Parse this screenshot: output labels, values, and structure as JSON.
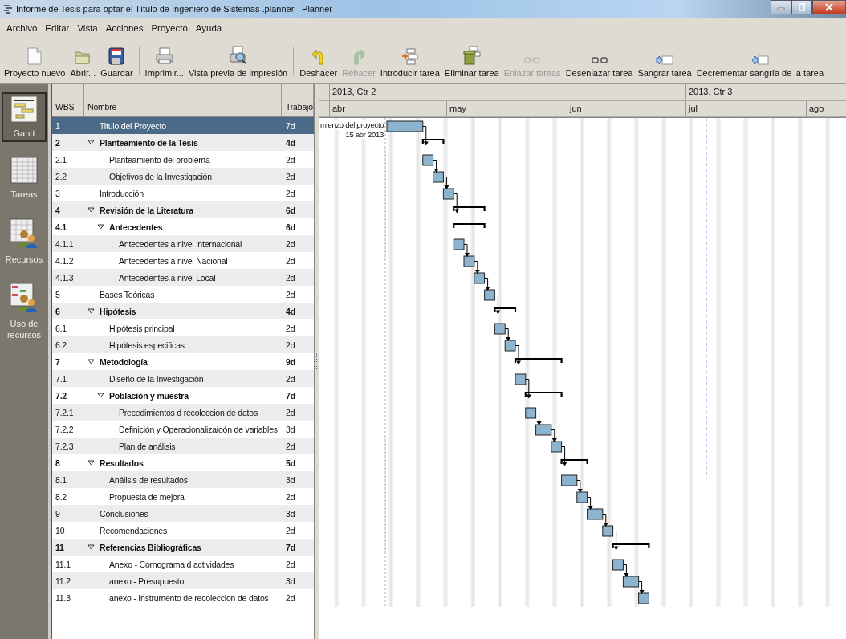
{
  "window": {
    "title": "Informe de Tesis para optar el Título de Ingeniero de Sistemas .planner - Planner"
  },
  "menu": [
    "Archivo",
    "Editar",
    "Vista",
    "Acciones",
    "Proyecto",
    "Ayuda"
  ],
  "toolbar": [
    [
      {
        "kind": "new",
        "label": "Proyecto nuevo",
        "disabled": false
      },
      {
        "kind": "open",
        "label": "Abrir...",
        "disabled": false
      },
      {
        "kind": "save",
        "label": "Guardar",
        "disabled": false
      }
    ],
    [
      {
        "kind": "print",
        "label": "Imprimir...",
        "disabled": false
      },
      {
        "kind": "preview",
        "label": "Vista previa de impresión",
        "disabled": false
      }
    ],
    [
      {
        "kind": "undo",
        "label": "Deshacer",
        "disabled": false
      },
      {
        "kind": "redo",
        "label": "Rehacer",
        "disabled": true
      },
      {
        "kind": "insert",
        "label": "Introducir tarea",
        "disabled": false
      },
      {
        "kind": "delete",
        "label": "Eliminar tarea",
        "disabled": false
      },
      {
        "kind": "link",
        "label": "Enlazar tareas",
        "disabled": true
      },
      {
        "kind": "unlink",
        "label": "Desenlazar tarea",
        "disabled": false
      },
      {
        "kind": "indent",
        "label": "Sangrar tarea",
        "disabled": false
      },
      {
        "kind": "unindent",
        "label": "Decrementar sangría de la tarea",
        "disabled": false
      }
    ]
  ],
  "sidebar": {
    "items": [
      {
        "kind": "gantt",
        "label": "Gantt",
        "selected": true
      },
      {
        "kind": "tasks",
        "label": "Tareas",
        "selected": false
      },
      {
        "kind": "resources",
        "label": "Recursos",
        "selected": false
      },
      {
        "kind": "usage",
        "label": "Uso de recursos",
        "selected": false
      }
    ]
  },
  "table": {
    "columns": [
      "WBS",
      "Nombre",
      "Trabajo"
    ],
    "rows": [
      {
        "wbs": "1",
        "name": "Titulo del Proyecto",
        "work": "7d",
        "selected": true
      },
      {
        "wbs": "2",
        "name": "Planteamiento de la Tesis",
        "work": "4d",
        "selected": false,
        "expanded": true,
        "children": [
          {
            "wbs": "2.1",
            "name": "Planteamiento del problema",
            "work": "2d",
            "selected": false
          },
          {
            "wbs": "2.2",
            "name": "Objetivos de la Investigación",
            "work": "2d",
            "selected": false
          }
        ]
      },
      {
        "wbs": "3",
        "name": "Introducción",
        "work": "2d",
        "selected": false
      },
      {
        "wbs": "4",
        "name": "Revisión de la Literatura",
        "work": "6d",
        "selected": false,
        "expanded": true,
        "children": [
          {
            "wbs": "4.1",
            "name": "Antecedentes",
            "work": "6d",
            "selected": false,
            "expanded": true,
            "children": [
              {
                "wbs": "4.1.1",
                "name": "Antecedentes a nivel internacional",
                "work": "2d",
                "selected": false
              },
              {
                "wbs": "4.1.2",
                "name": "Antecedentes a nivel Nacional",
                "work": "2d",
                "selected": false
              },
              {
                "wbs": "4.1.3",
                "name": "Antecedentes a nivel Local",
                "work": "2d",
                "selected": false
              }
            ]
          }
        ]
      },
      {
        "wbs": "5",
        "name": "Bases Teóricas",
        "work": "2d",
        "selected": false
      },
      {
        "wbs": "6",
        "name": "Hipótesis",
        "work": "4d",
        "selected": false,
        "expanded": true,
        "children": [
          {
            "wbs": "6.1",
            "name": "Hipótesis principal",
            "work": "2d",
            "selected": false
          },
          {
            "wbs": "6.2",
            "name": "Hipótesis especificas",
            "work": "2d",
            "selected": false
          }
        ]
      },
      {
        "wbs": "7",
        "name": "Metodología",
        "work": "9d",
        "selected": false,
        "expanded": true,
        "children": [
          {
            "wbs": "7.1",
            "name": "Diseño de la Investigación",
            "work": "2d",
            "selected": false
          },
          {
            "wbs": "7.2",
            "name": "Población y muestra",
            "work": "7d",
            "selected": false,
            "expanded": true,
            "children": [
              {
                "wbs": "7.2.1",
                "name": "Precedimientos d recoleccion de datos",
                "work": "2d",
                "selected": false
              },
              {
                "wbs": "7.2.2",
                "name": "Definición y Operacionalizaioón de variables",
                "work": "3d",
                "selected": false
              },
              {
                "wbs": "7.2.3",
                "name": "Plan de análisis",
                "work": "2d",
                "selected": false
              }
            ]
          }
        ]
      },
      {
        "wbs": "8",
        "name": "Resultados",
        "work": "5d",
        "selected": false,
        "expanded": true,
        "children": [
          {
            "wbs": "8.1",
            "name": "Análisis de resultados",
            "work": "3d",
            "selected": false
          },
          {
            "wbs": "8.2",
            "name": "Propuesta de mejora",
            "work": "2d",
            "selected": false
          }
        ]
      },
      {
        "wbs": "9",
        "name": "Conclusiones",
        "work": "3d",
        "selected": false
      },
      {
        "wbs": "10",
        "name": "Recomendaciones",
        "work": "2d",
        "selected": false
      },
      {
        "wbs": "11",
        "name": "Referencias Bibliográficas",
        "work": "7d",
        "selected": false,
        "expanded": true,
        "children": [
          {
            "wbs": "11.1",
            "name": "Anexo - Cornograma d actividades",
            "work": "2d",
            "selected": false
          },
          {
            "wbs": "11.2",
            "name": "anexo - Presupuesto",
            "work": "3d",
            "selected": false
          },
          {
            "wbs": "11.3",
            "name": "anexo - Instrumento de recoleccion de datos",
            "work": "2d",
            "selected": false
          }
        ]
      }
    ]
  },
  "gantt": {
    "quarters": [
      "2013, Ctr 2",
      "2013, Ctr 3"
    ],
    "months": [
      "abr",
      "may",
      "jun",
      "jul",
      "ago"
    ],
    "project_start": {
      "label": "mienzo del proyecto",
      "date": "15 abr 2013"
    }
  }
}
